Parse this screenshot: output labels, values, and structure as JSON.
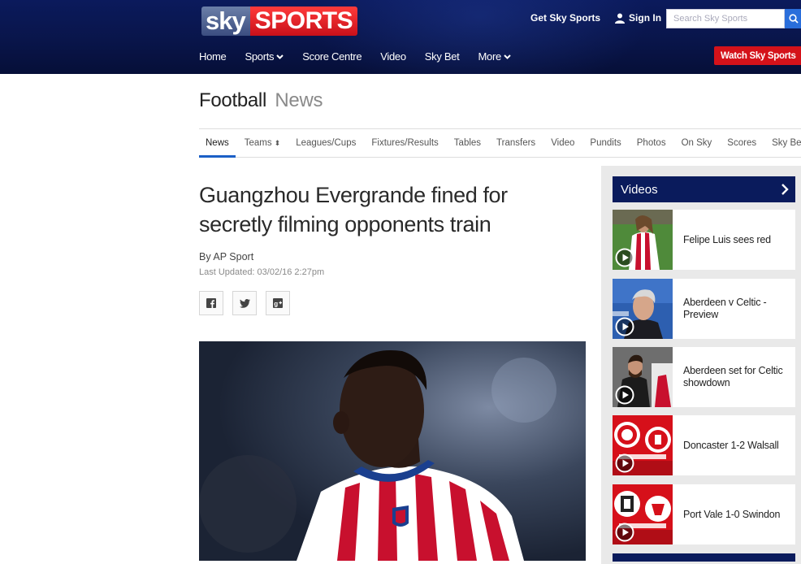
{
  "header": {
    "logo_sky": "sky",
    "logo_sports": "SPORTS",
    "get_sky_sports": "Get Sky Sports",
    "sign_in": "Sign In",
    "search_placeholder": "Search Sky Sports",
    "watch_button": "Watch Sky Sports",
    "nav": [
      {
        "label": "Home",
        "dropdown": false
      },
      {
        "label": "Sports",
        "dropdown": true
      },
      {
        "label": "Score Centre",
        "dropdown": false
      },
      {
        "label": "Video",
        "dropdown": false
      },
      {
        "label": "Sky Bet",
        "dropdown": false
      },
      {
        "label": "More",
        "dropdown": true
      }
    ],
    "colors": {
      "navy": "#0b1a5c",
      "red": "#d4121a",
      "search_blue": "#2a6edb"
    }
  },
  "section": {
    "title": "Football",
    "subtitle": "News",
    "tabs": [
      "News",
      "Teams",
      "Leagues/Cups",
      "Fixtures/Results",
      "Tables",
      "Transfers",
      "Video",
      "Pundits",
      "Photos",
      "On Sky",
      "Scores",
      "Sky Bet"
    ],
    "active_tab": "News"
  },
  "article": {
    "headline": "Guangzhou Evergrande fined for secretly filming opponents train",
    "byline": "By AP Sport",
    "updated": "Last Updated: 03/02/16 2:27pm",
    "share": [
      "facebook-icon",
      "twitter-icon",
      "google-plus-icon"
    ]
  },
  "sidebar": {
    "videos_title": "Videos",
    "videos": [
      {
        "title": "Felipe Luis sees red"
      },
      {
        "title": "Aberdeen v Celtic - Preview"
      },
      {
        "title": "Aberdeen set for Celtic showdown"
      },
      {
        "title": "Doncaster 1-2 Walsall"
      },
      {
        "title": "Port Vale 1-0 Swindon"
      }
    ]
  }
}
